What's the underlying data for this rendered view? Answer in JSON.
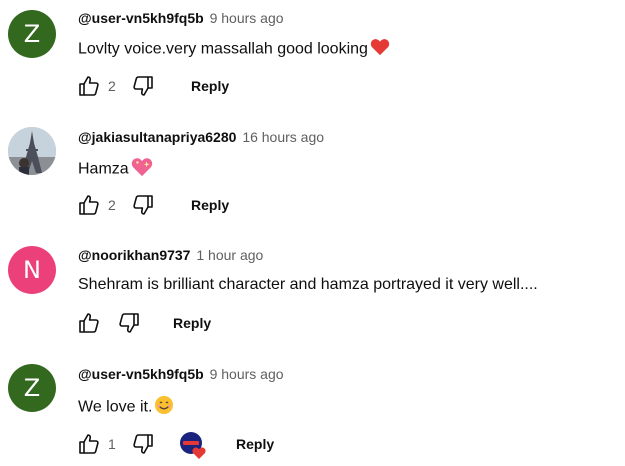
{
  "comments": [
    {
      "author": "@user-vn5kh9fq5b",
      "time": "9 hours ago",
      "text": "Lovlty  voice.very massallah good looking",
      "emoji": "red-heart",
      "avatar_letter": "Z",
      "avatar_color": "#33691e",
      "likes": "2",
      "reply_label": "Reply"
    },
    {
      "author": "@jakiasultanapriya6280",
      "time": "16 hours ago",
      "text": "Hamza",
      "emoji": "sparkling-heart",
      "avatar_letter": "",
      "avatar_color": "#b0bec5",
      "likes": "2",
      "reply_label": "Reply"
    },
    {
      "author": "@noorikhan9737",
      "time": "1 hour ago",
      "text": "Shehram is brilliant character and hamza portrayed it very well....",
      "emoji": "",
      "avatar_letter": "N",
      "avatar_color": "#ec407a",
      "likes": "",
      "reply_label": "Reply"
    },
    {
      "author": "@user-vn5kh9fq5b",
      "time": "9 hours ago",
      "text": "We love it.",
      "emoji": "smiling-face",
      "avatar_letter": "Z",
      "avatar_color": "#33691e",
      "likes": "1",
      "reply_label": "Reply",
      "creator_heart": true
    }
  ],
  "colors": {
    "heart_red": "#e53935",
    "like_icon": "#0f0f0f",
    "secondary_text": "#606060"
  }
}
